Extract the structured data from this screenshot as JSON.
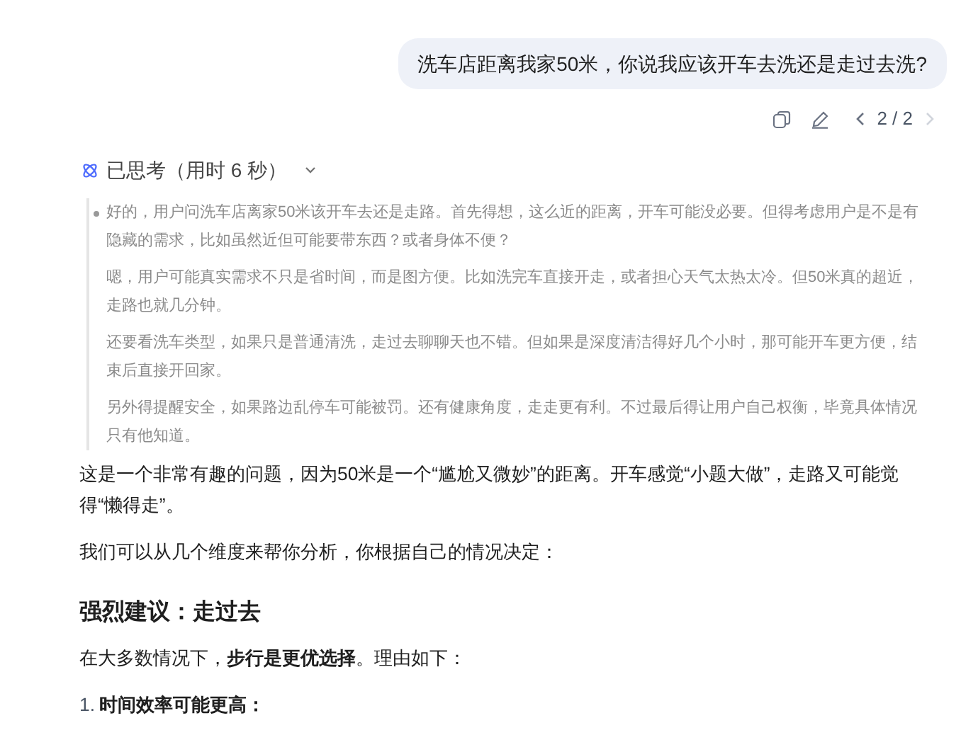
{
  "user_message": {
    "text": "洗车店距离我家50米，你说我应该开车去洗还是走过去洗?"
  },
  "message_actions": {
    "pager": "2 / 2",
    "prev_disabled": false,
    "next_disabled": true
  },
  "thinking": {
    "title": "已思考（用时 6 秒）",
    "expanded": true,
    "paragraphs": [
      "好的，用户问洗车店离家50米该开车去还是走路。首先得想，这么近的距离，开车可能没必要。但得考虑用户是不是有隐藏的需求，比如虽然近但可能要带东西？或者身体不便？",
      "嗯，用户可能真实需求不只是省时间，而是图方便。比如洗完车直接开走，或者担心天气太热太冷。但50米真的超近，走路也就几分钟。",
      "还要看洗车类型，如果只是普通清洗，走过去聊聊天也不错。但如果是深度清洁得好几个小时，那可能开车更方便，结束后直接开回家。",
      "另外得提醒安全，如果路边乱停车可能被罚。还有健康角度，走走更有利。不过最后得让用户自己权衡，毕竟具体情况只有他知道。"
    ]
  },
  "answer": [
    {
      "kind": "paragraph",
      "text": "这是一个非常有趣的问题，因为50米是一个“尴尬又微妙”的距离。开车感觉“小题大做”，走路又可能觉得“懒得走”。"
    },
    {
      "kind": "paragraph",
      "text": "我们可以从几个维度来帮你分析，你根据自己的情况决定："
    },
    {
      "kind": "heading",
      "text": "强烈建议：走过去"
    },
    {
      "kind": "paragraph",
      "text": "在大多数情况下，**步行是更优选择**。理由如下："
    },
    {
      "kind": "list_item",
      "number": "1.",
      "text": "时间效率可能更高："
    }
  ]
}
